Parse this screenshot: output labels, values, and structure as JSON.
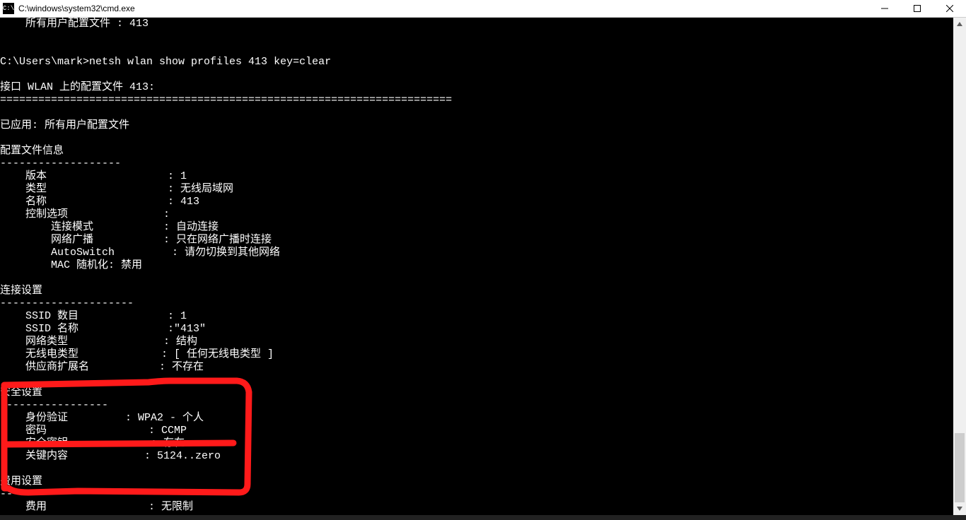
{
  "window": {
    "title": "C:\\windows\\system32\\cmd.exe",
    "icon_label": "C:\\"
  },
  "terminal": {
    "line_all_profiles": "    所有用户配置文件 : 413",
    "blank": "",
    "promptline": "C:\\Users\\mark>netsh wlan show profiles 413 key=clear",
    "header_line": "接口 WLAN 上的配置文件 413:",
    "divider_eq": "=======================================================================",
    "applied_line": "已应用: 所有用户配置文件",
    "section_profile": "配置文件信息",
    "dashes": "-------------------",
    "kv_version": "    版本                   : 1",
    "kv_type": "    类型                   : 无线局域网",
    "kv_name": "    名称                   : 413",
    "kv_ctrl": "    控制选项               :",
    "kv_connmode": "        连接模式           : 自动连接",
    "kv_bcast": "        网络广播           : 只在网络广播时连接",
    "kv_autoswitch": "        AutoSwitch         : 请勿切换到其他网络",
    "kv_macrand": "        MAC 随机化: 禁用",
    "section_conn": "连接设置",
    "dashes2": "---------------------",
    "kv_ssidcount": "    SSID 数目              : 1",
    "kv_ssidname": "    SSID 名称              :\"413\"",
    "kv_nettype": "    网络类型               : 结构",
    "kv_radiotype": "    无线电类型             : [ 任何无线电类型 ]",
    "kv_vendor": "    供应商扩展名           : 不存在",
    "section_sec": "安全设置",
    "dashes3": "-----------------",
    "kv_auth": "    身份验证         : WPA2 - 个人",
    "kv_cipher": "    密码                : CCMP",
    "kv_seckey": "    安全密钥             : 存在",
    "kv_keycontent": "    关键内容            : 5124..zero",
    "section_cost": "费用设置",
    "dashes4": "-------------",
    "kv_cost": "    费用                : 无限制"
  }
}
